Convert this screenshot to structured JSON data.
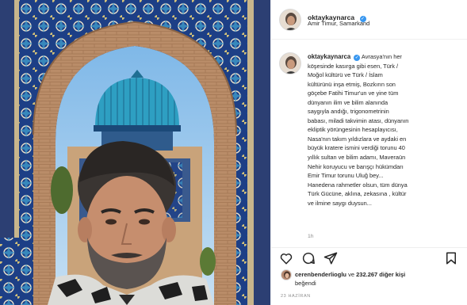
{
  "post": {
    "username": "oktaykaynarca",
    "verified_icon": "verified-badge-icon",
    "location": "Amir Timur, Samarkand",
    "caption_lines": [
      "Avrasya'nın her",
      "köşesinde kasırga gibi esen, Türk /",
      "Moğol kültürü ve Türk / İslam",
      "kültürünü inşa etmiş, Bozkırın son",
      "göçebe Fatihi Timur'un ve yine tüm",
      "dünyanın ilim ve bilim alanında",
      "saygıyla andığı, trigonometrinin",
      "babası, miladi takvimin atası, dünyanın",
      "ekliptik yörüngesinin hesaplayıcısı,",
      "Nasa'nın takım yıldızlara ve aydaki en",
      "büyük kratere ismini verdiği torunu 40",
      "yıllık sultan ve bilim adamı, Maveraün",
      "Nehir koruyucu ve barışçı hükümdarı",
      "Emir Timur torunu Uluğ bey...",
      "Hanedena rahmetler olsun, tüm dünya",
      "Türk Gücüne, aklına, zekasına , kültür",
      "ve ilmine saygı duysun..."
    ],
    "time_ago": "1h",
    "likes": {
      "first_liker": "cerenbenderlioglu",
      "connector": " ve ",
      "count_text": "232.267 diğer kişi",
      "suffix": "beğendi"
    },
    "date": "23 HAZİRAN"
  },
  "icons": {
    "like": "heart-icon",
    "comment": "comment-icon",
    "share": "share-icon",
    "save": "bookmark-icon"
  },
  "colors": {
    "verified": "#3897f0",
    "text": "#262626",
    "muted": "#8e8e8e",
    "border": "#efefef"
  }
}
